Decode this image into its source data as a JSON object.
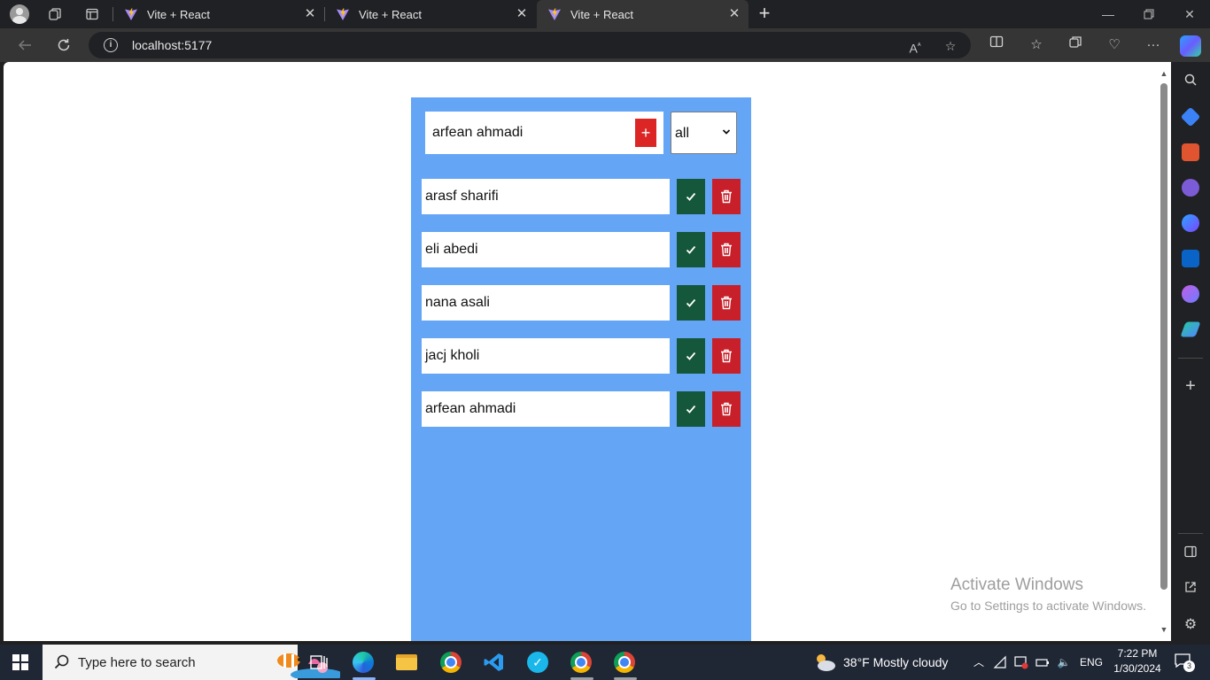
{
  "browser": {
    "tabs": [
      {
        "title": "Vite + React",
        "active": false
      },
      {
        "title": "Vite + React",
        "active": false
      },
      {
        "title": "Vite + React",
        "active": true
      }
    ],
    "url": "localhost:5177"
  },
  "app": {
    "add_input_value": "arfean ahmadi",
    "add_button_label": "+",
    "filter_value": "all",
    "todos": [
      {
        "text": "arasf sharifi"
      },
      {
        "text": "eli abedi"
      },
      {
        "text": "nana asali"
      },
      {
        "text": "jacj kholi"
      },
      {
        "text": "arfean ahmadi"
      }
    ]
  },
  "watermark": {
    "line1": "Activate Windows",
    "line2": "Go to Settings to activate Windows."
  },
  "taskbar": {
    "search_placeholder": "Type here to search",
    "weather": "38°F  Mostly cloudy",
    "language": "ENG",
    "time": "7:22 PM",
    "date": "1/30/2024",
    "notification_count": "3"
  },
  "colors": {
    "app_background": "#64a5f6",
    "check_button": "#15573a",
    "delete_button": "#c8202a",
    "add_button": "#dc2626"
  }
}
